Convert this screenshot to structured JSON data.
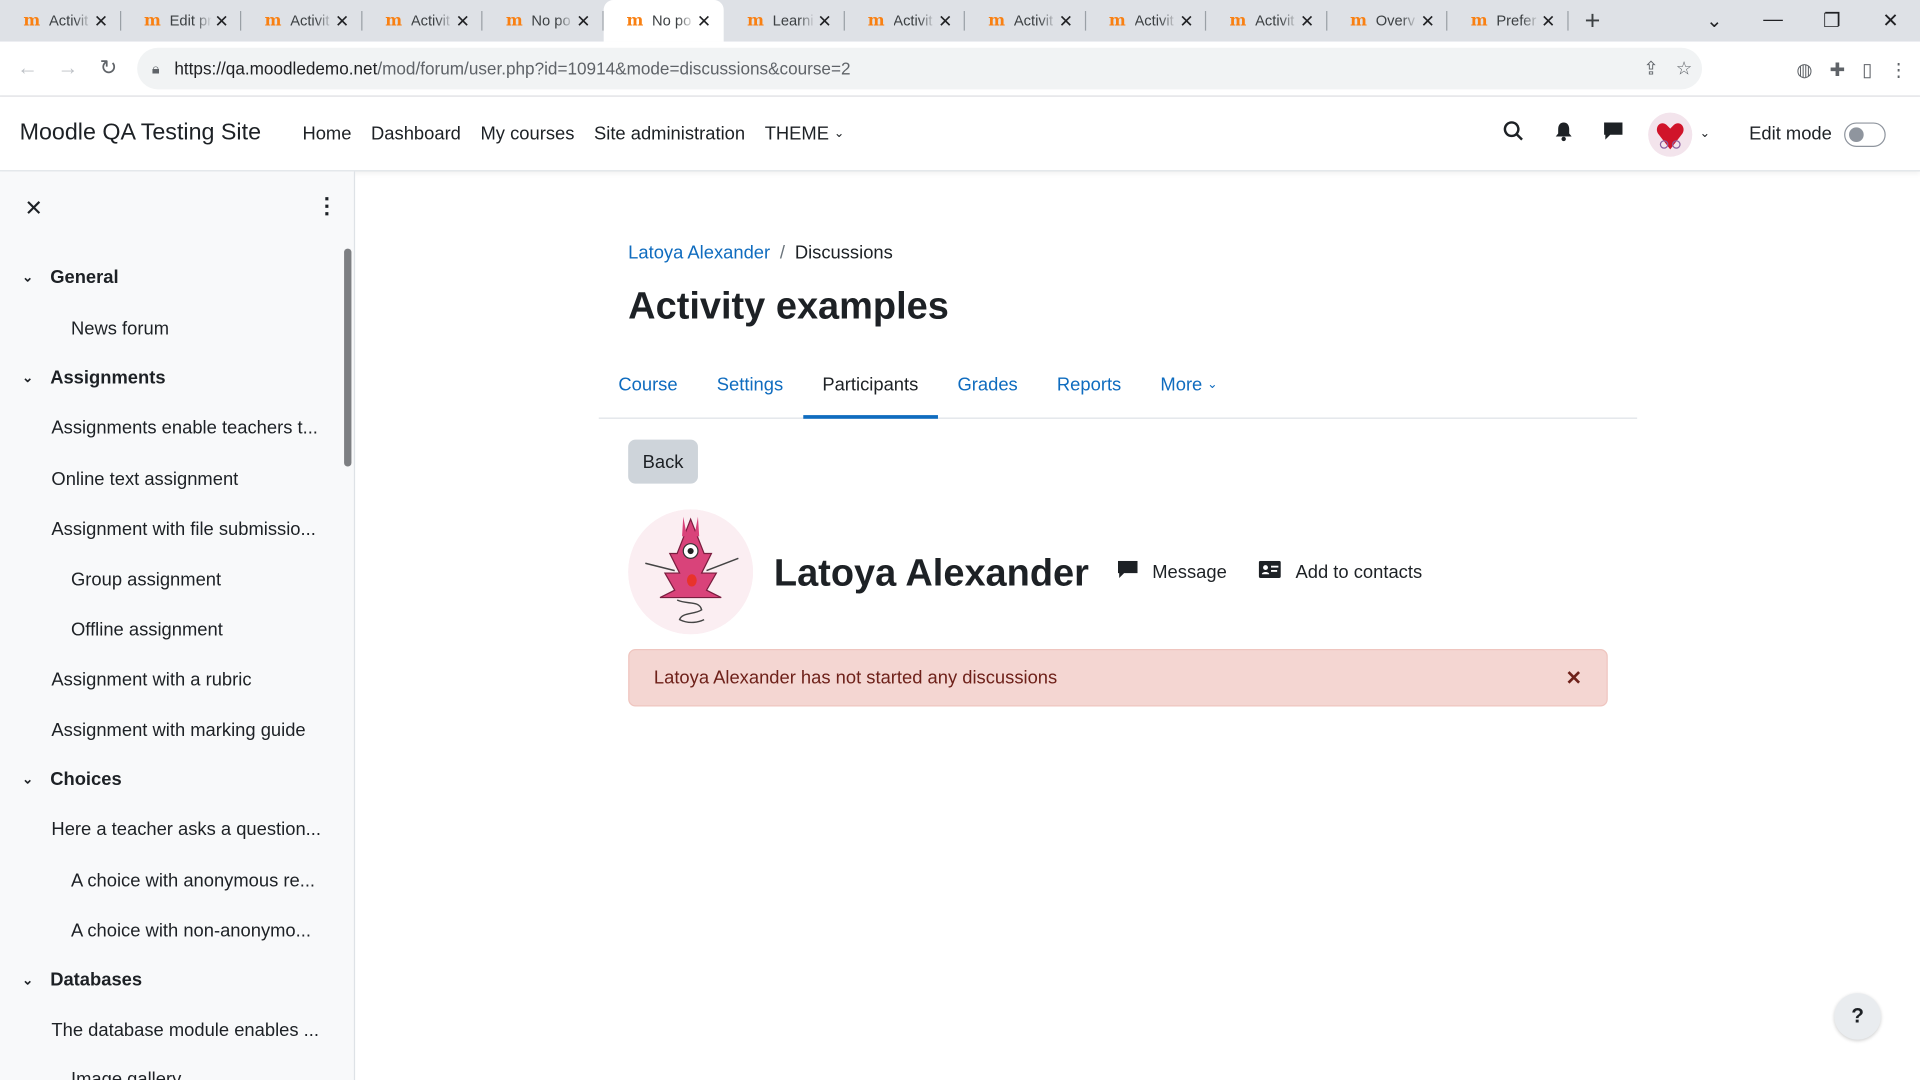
{
  "browser": {
    "tabs": [
      {
        "title": "Activit",
        "active": false
      },
      {
        "title": "Edit pr",
        "active": false
      },
      {
        "title": "Activit",
        "active": false
      },
      {
        "title": "Activit",
        "active": false
      },
      {
        "title": "No po",
        "active": false
      },
      {
        "title": "No po",
        "active": true
      },
      {
        "title": "Learni",
        "active": false
      },
      {
        "title": "Activit",
        "active": false
      },
      {
        "title": "Activit",
        "active": false
      },
      {
        "title": "Activit",
        "active": false
      },
      {
        "title": "Activit",
        "active": false
      },
      {
        "title": "Overv",
        "active": false
      },
      {
        "title": "Prefer",
        "active": false
      }
    ],
    "url_host": "https://qa.moodledemo.net",
    "url_path": "/mod/forum/user.php?id=10914&mode=discussions&course=2"
  },
  "navbar": {
    "brand": "Moodle QA Testing Site",
    "links": [
      "Home",
      "Dashboard",
      "My courses",
      "Site administration"
    ],
    "theme_label": "THEME",
    "edit_mode_label": "Edit mode"
  },
  "course_index": {
    "sections": [
      {
        "label": "General"
      },
      {
        "label": "Assignments"
      },
      {
        "label": "Choices"
      },
      {
        "label": "Databases"
      }
    ],
    "items": [
      "News forum",
      "Assignments enable teachers t...",
      "Online text assignment",
      "Assignment with file submissio...",
      "Group assignment",
      "Offline assignment",
      "Assignment with a rubric",
      "Assignment with marking guide",
      "Here a teacher asks a question...",
      "A choice with anonymous re...",
      "A choice with non-anonymo...",
      "The database module enables ...",
      "Image gallery"
    ]
  },
  "main": {
    "breadcrumb": {
      "user_link": "Latoya Alexander",
      "separator": "/",
      "current": "Discussions"
    },
    "page_title": "Activity examples",
    "tabs": [
      "Course",
      "Settings",
      "Participants",
      "Grades",
      "Reports"
    ],
    "more_label": "More",
    "back_label": "Back",
    "profile_name": "Latoya Alexander",
    "message_label": "Message",
    "add_contact_label": "Add to contacts",
    "alert_text": "Latoya Alexander has not started any discussions"
  },
  "help_label": "?",
  "colors": {
    "link": "#0f6cbf",
    "alert_bg": "#f4d6d2",
    "alert_text": "#6e211a",
    "moodle_orange": "#f98012"
  }
}
